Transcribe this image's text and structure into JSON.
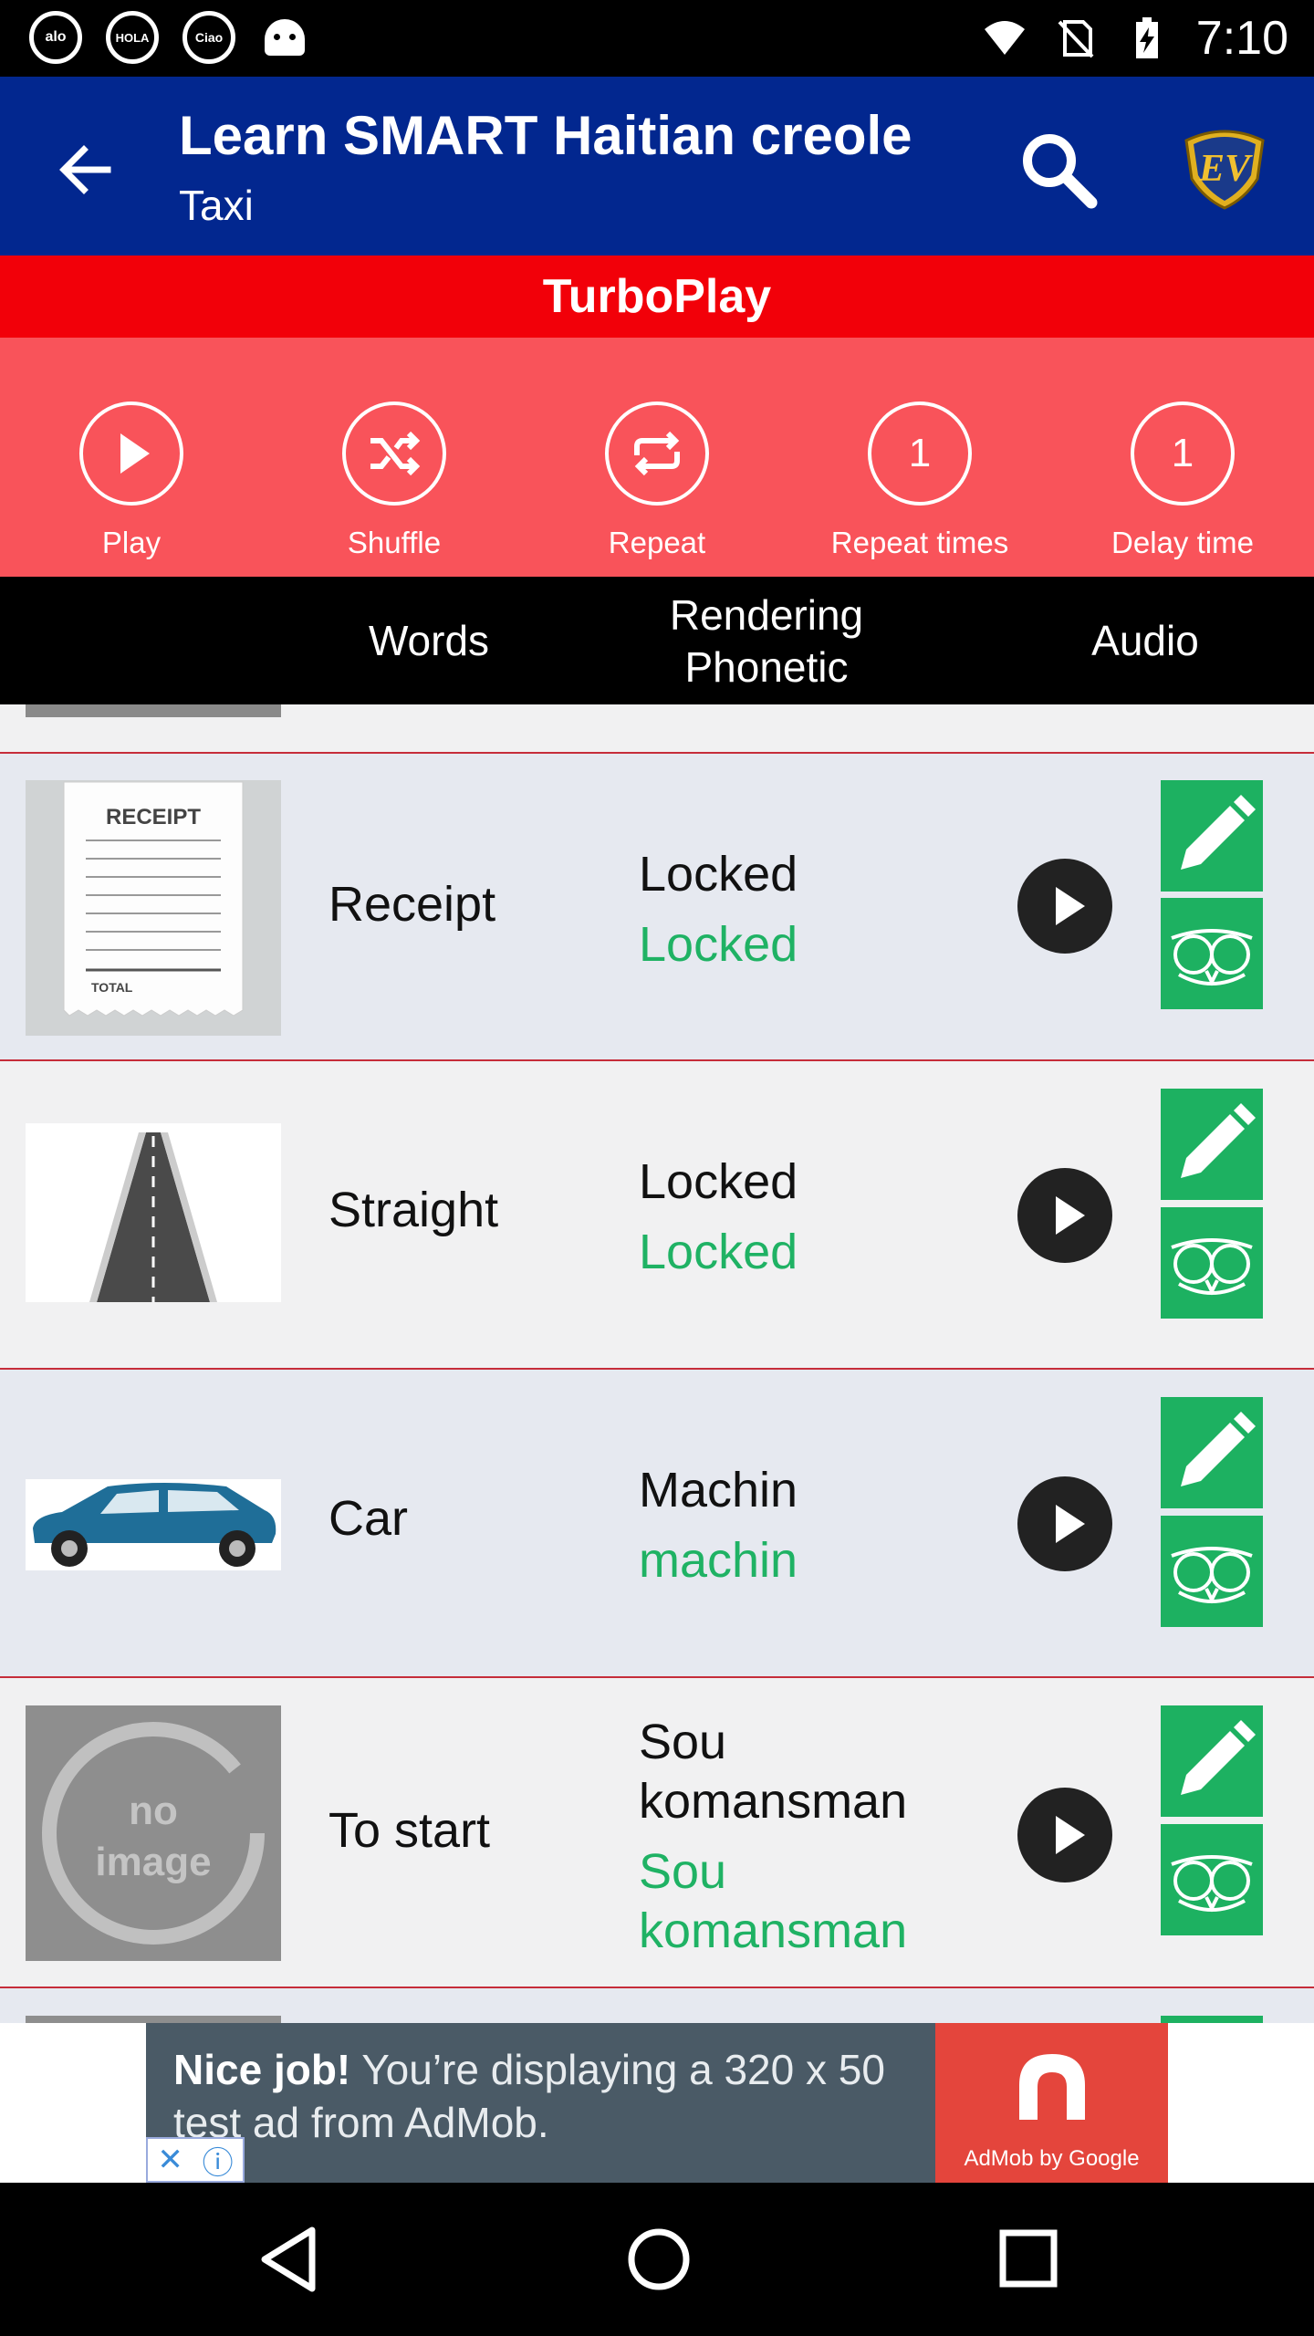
{
  "status_bar": {
    "time": "7:10",
    "notification_icons": [
      "alo",
      "HOLA",
      "Ciao"
    ],
    "right_icons": [
      "wifi-icon",
      "no-sim-icon",
      "battery-charging-icon"
    ]
  },
  "app_bar": {
    "title": "Learn SMART Haitian creole",
    "subtitle": "Taxi",
    "logo_text": "EV"
  },
  "turbo": {
    "heading": "TurboPlay",
    "controls": [
      {
        "label": "Play",
        "icon": "play-icon"
      },
      {
        "label": "Shuffle",
        "icon": "shuffle-icon"
      },
      {
        "label": "Repeat",
        "icon": "repeat-icon"
      },
      {
        "label": "Repeat times",
        "value": "1"
      },
      {
        "label": "Delay time",
        "value": "1"
      }
    ]
  },
  "columns": {
    "words": "Words",
    "rendering": "Rendering\nPhonetic",
    "audio": "Audio"
  },
  "rows": [
    {
      "word": "Receipt",
      "native": "Locked",
      "phonetic": "Locked",
      "image": "receipt",
      "receipt_title": "RECEIPT",
      "receipt_total": "TOTAL"
    },
    {
      "word": "Straight",
      "native": "Locked",
      "phonetic": "Locked",
      "image": "road"
    },
    {
      "word": "Car",
      "native": "Machin",
      "phonetic": "machin",
      "image": "car"
    },
    {
      "word": "To start",
      "native": "Sou komansman",
      "phonetic": "Sou komansman",
      "image": "no-image",
      "noimage_text": "no image"
    }
  ],
  "ad": {
    "bold": "Nice job!",
    "text": " You’re displaying a 320 x 50 test ad from AdMob.",
    "brand": "AdMob by Google"
  },
  "colors": {
    "app_bar": "#02278f",
    "turbo_header": "#f20009",
    "turbo_panel": "#f9535a",
    "green": "#1fb264"
  }
}
